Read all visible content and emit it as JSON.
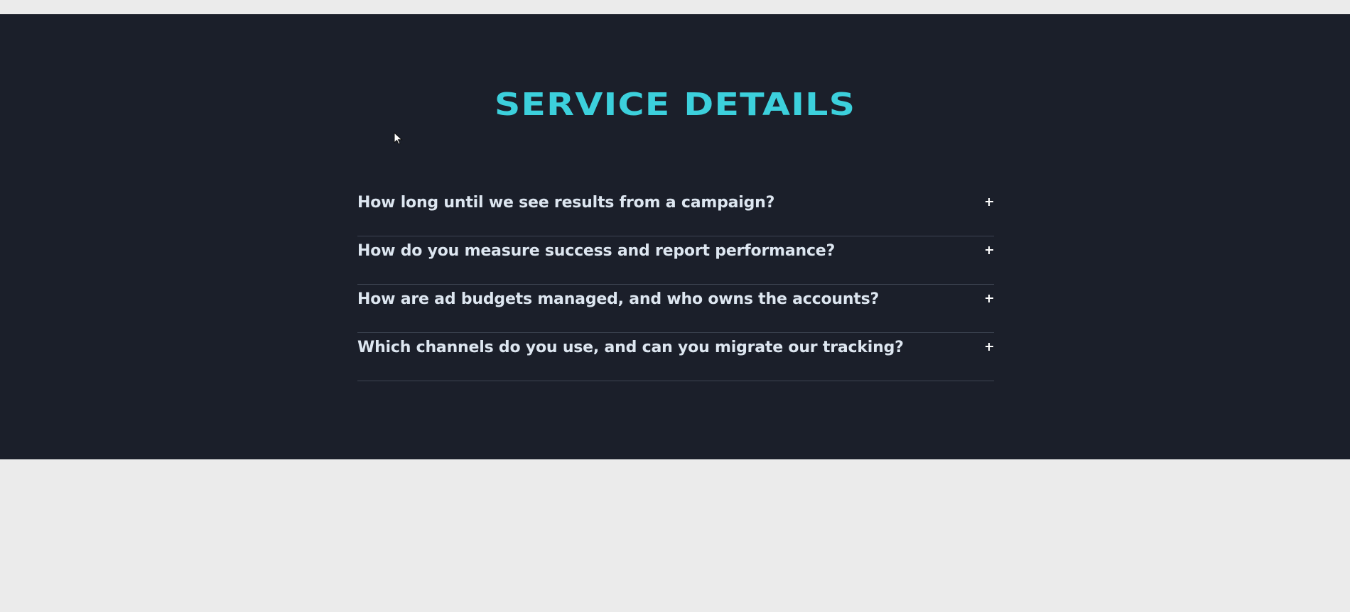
{
  "section": {
    "title": "SERVICE DETAILS"
  },
  "faq": {
    "items": [
      {
        "question": "How long until we see results from a campaign?",
        "toggle_icon": "plus-icon"
      },
      {
        "question": "How do you measure success and report performance?",
        "toggle_icon": "plus-icon"
      },
      {
        "question": "How are ad budgets managed, and who owns the accounts?",
        "toggle_icon": "plus-icon"
      },
      {
        "question": "Which channels do you use, and can you migrate our tracking?",
        "toggle_icon": "plus-icon"
      }
    ]
  },
  "colors": {
    "page_background": "#ebebeb",
    "section_background": "#1b1f2a",
    "title_accent": "#3cd0dc",
    "question_text": "#dde6f0",
    "divider": "#3d4452"
  }
}
